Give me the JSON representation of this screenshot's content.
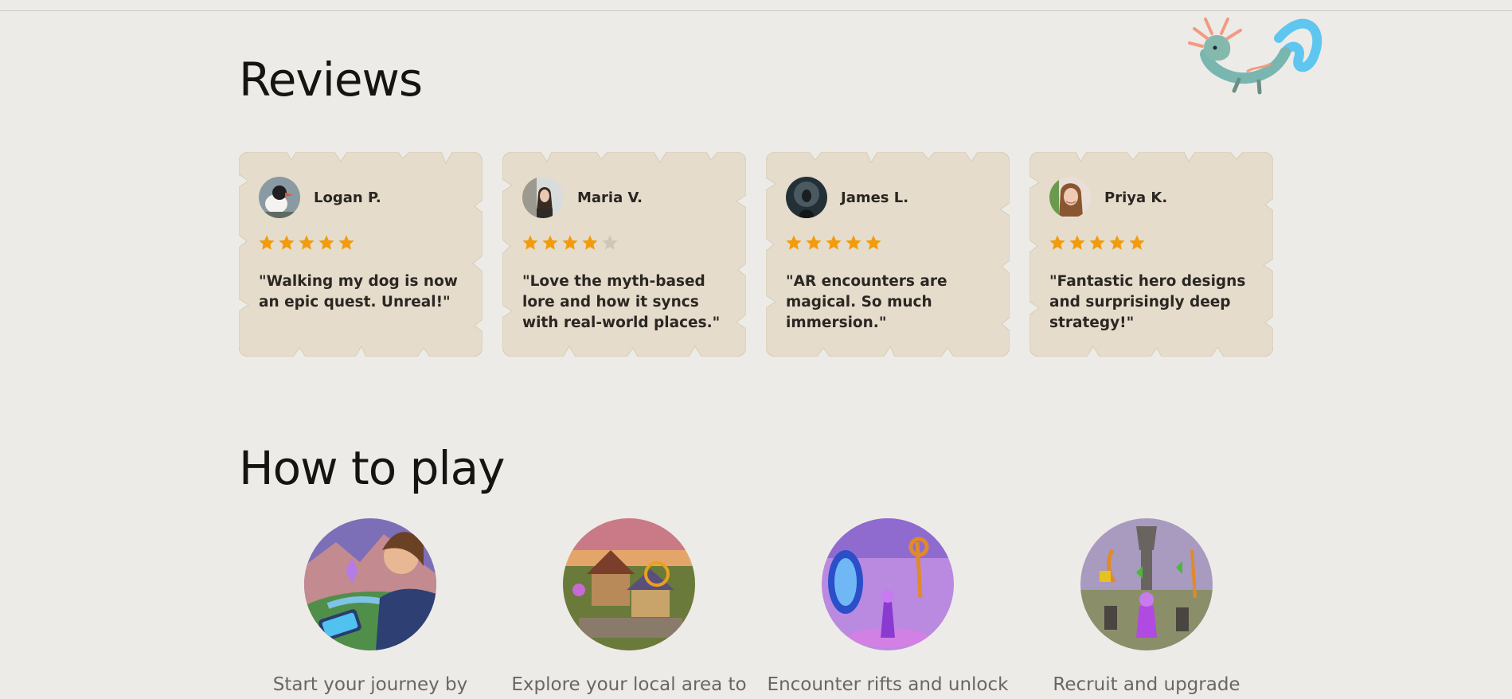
{
  "sections": {
    "reviews_title": "Reviews",
    "howto_title": "How to play"
  },
  "reviews": [
    {
      "name": "Logan P.",
      "rating": 5,
      "quote": "\"Walking my dog is now an epic quest. Unreal!\""
    },
    {
      "name": "Maria V.",
      "rating": 4,
      "quote": "\"Love the myth-based lore and how it syncs with real-world places.\""
    },
    {
      "name": "James L.",
      "rating": 5,
      "quote": "\"AR encounters are magical. So much immersion.\""
    },
    {
      "name": "Priya K.",
      "rating": 5,
      "quote": "\"Fantastic hero designs and surprisingly deep strategy!\""
    }
  ],
  "steps": [
    {
      "text": "Start your journey by",
      "icon": "hero-phone-illustration"
    },
    {
      "text": "Explore your local area to",
      "icon": "village-illustration"
    },
    {
      "text": "Encounter rifts and unlock",
      "icon": "rift-portal-illustration"
    },
    {
      "text": "Recruit and upgrade",
      "icon": "hero-recruit-illustration"
    }
  ],
  "colors": {
    "background": "#edebe8",
    "card": "#e5dccb",
    "star_filled": "#f29b0c",
    "star_empty": "#cfc6b4"
  }
}
